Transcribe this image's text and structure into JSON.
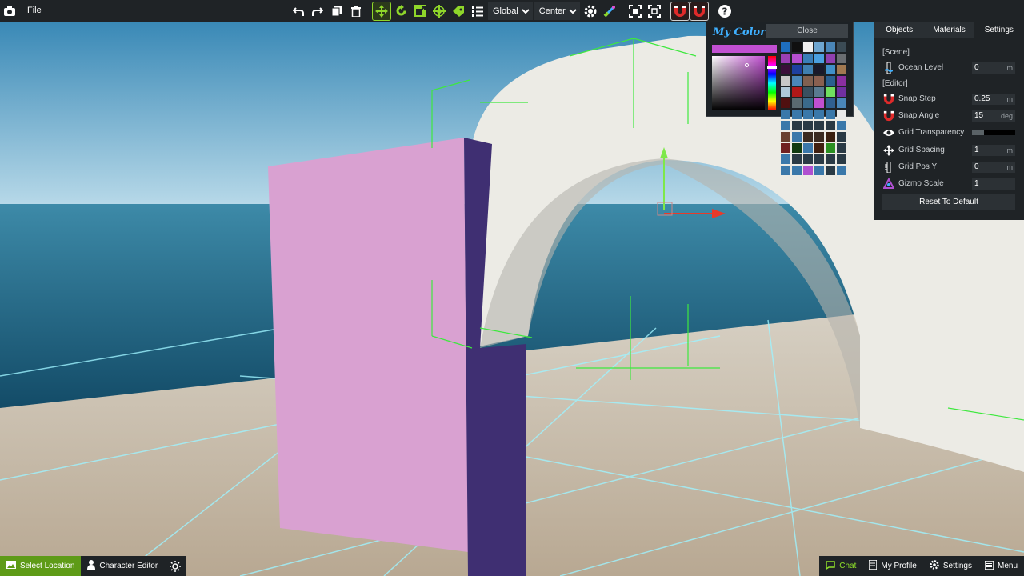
{
  "toolbar": {
    "file_label": "File",
    "space_mode": "Global",
    "pivot_mode": "Center"
  },
  "icons": {
    "camera": "camera-icon",
    "undo": "undo-icon",
    "redo": "redo-icon",
    "copy": "copy-icon",
    "delete": "trash-icon",
    "move": "move-icon",
    "rotate": "rotate-icon",
    "scale": "scale-icon",
    "multi": "multi-transform-icon",
    "tag": "tag-icon",
    "list": "list-icon",
    "gizmo": "settings-gear-icon",
    "paint": "paint-icon",
    "focus": "focus-icon",
    "frame": "frame-icon",
    "snap1": "magnet-icon",
    "snap2": "magnet-angle-icon",
    "help": "help-icon"
  },
  "color_picker": {
    "title": "My Colors",
    "close_label": "Close",
    "current_color": "#c14fd2"
  },
  "swatches": [
    "#1e6fc0",
    "#101010",
    "#f0f0f0",
    "#6ea6d0",
    "#4a86b8",
    "#3b4b55",
    "#9a40b4",
    "#b64fd0",
    "#3a7fb8",
    "#4aa0e0",
    "#9040b0",
    "#6a6e72",
    "#3a0f3a",
    "#1e40a0",
    "#3f7fb0",
    "#1a1a2a",
    "#4090c8",
    "#a07850",
    "#c8c8c8",
    "#4a86b8",
    "#806050",
    "#8a6050",
    "#2a6090",
    "#8a2fa0",
    "#b0c8d8",
    "#b01818",
    "#3a5060",
    "#5a7a90",
    "#70e060",
    "#7030a0",
    "#501010",
    "#5a6a70",
    "#3a6a8a",
    "#c050d0",
    "#306090",
    "#4a86b8",
    "#3a78aa",
    "#3a78aa",
    "#3a78aa",
    "#3a78aa",
    "#3a78aa",
    "#e8e8e8",
    "#3a78aa",
    "#2a3a45",
    "#2a3a45",
    "#2a3a45",
    "#2a3a45",
    "#3a78aa",
    "#6a4030",
    "#3a78aa",
    "#3a2a20",
    "#3a2a20",
    "#3a2010",
    "#2a3a45",
    "#702020",
    "#103a10",
    "#3a78aa",
    "#402010",
    "#2a9020",
    "#2a3a45",
    "#3a78aa",
    "#2a3a45",
    "#2a3a45",
    "#2a3a45",
    "#2a3a45",
    "#2a3a45",
    "#3a78aa",
    "#3a78aa",
    "#b050d0",
    "#3a78aa",
    "#2a3a45",
    "#3a78aa"
  ],
  "panel": {
    "tabs": [
      "Objects",
      "Materials",
      "Settings"
    ],
    "scene_label": "[Scene]",
    "editor_label": "[Editor]",
    "ocean_level": {
      "label": "Ocean Level",
      "value": "0",
      "unit": "m"
    },
    "snap_step": {
      "label": "Snap Step",
      "value": "0.25",
      "unit": "m"
    },
    "snap_angle": {
      "label": "Snap Angle",
      "value": "15",
      "unit": "deg"
    },
    "grid_transparency": {
      "label": "Grid Transparency",
      "level": 0.27
    },
    "grid_spacing": {
      "label": "Grid Spacing",
      "value": "1",
      "unit": "m"
    },
    "grid_pos_y": {
      "label": "Grid Pos Y",
      "value": "0",
      "unit": "m"
    },
    "gizmo_scale": {
      "label": "Gizmo Scale",
      "value": "1"
    },
    "reset_label": "Reset To Default"
  },
  "bottom": {
    "select_location": "Select Location",
    "character_editor": "Character Editor",
    "chat": "Chat",
    "my_profile": "My Profile",
    "settings": "Settings",
    "menu": "Menu"
  },
  "colors": {
    "accent_green": "#8fd62a",
    "panel_bg": "#1f2326",
    "select_location_bg": "#5e9b17"
  }
}
